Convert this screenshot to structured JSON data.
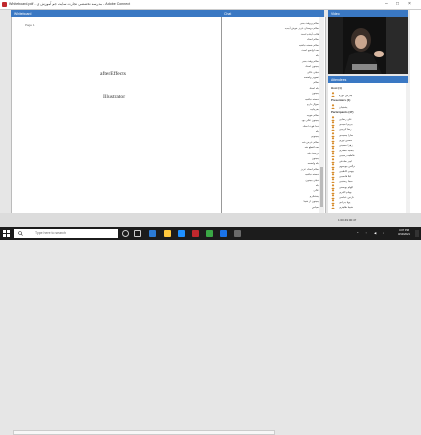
{
  "window": {
    "title": "Whiteboard.pdf - مدرسه تخصصی تجارت سایت جم آموزش ی - Adobe Connect"
  },
  "whiteboard": {
    "header": "Whiteboard",
    "page_label": "Page 1",
    "items": [
      "afterEffects",
      "Illustrator"
    ]
  },
  "chat": {
    "header": "Chat",
    "messages": [
      "سلام و وقت بخیر",
      "سلام دوستان عزیز خوش آمدید",
      "قالب آماده است",
      "سلام استاد",
      "سلام خسته نباشید",
      "صدا واضح است",
      "بله",
      "سلام وقت بخیر",
      "ممنون استاد",
      "خیلی عالی",
      "تصویر واضحه",
      "سلام",
      "بله استاد",
      "ممنون",
      "خسته نباشید",
      "سوال دارم",
      "بفرمایید",
      "سلام خوبید",
      "ممنون عالی بود",
      "خدا قوت استاد",
      "بله",
      "ممنونم",
      "سلام عرض شد",
      "صدا قطع شد",
      "درست شد",
      "ممنون",
      "بله واضحه",
      "سلام استاد عزیز",
      "خسته نباشید",
      "خیلی ممنون",
      "بله",
      "عالی",
      "متشکرم",
      "ممنون از شما",
      "سپاس"
    ]
  },
  "video": {
    "header": "Video"
  },
  "attendees": {
    "header": "Attendees",
    "groups": [
      {
        "label": "Host (1)",
        "names": [
          "مدرس دوره"
        ]
      },
      {
        "label": "Presenters (1)",
        "names": [
          "پشتیبان"
        ]
      },
      {
        "label": "Participants (47)",
        "names": [
          "علی رضایی",
          "مریم احمدی",
          "رضا کریمی",
          "سارا محمدی",
          "حسین نوری",
          "زهرا حسینی",
          "محمد جعفری",
          "فاطمه رحیمی",
          "امیر صادقی",
          "نرگس موسوی",
          "مهدی کاظمی",
          "لیلا قاسمی",
          "سینا رستمی",
          "الهام یوسفی",
          "بهنام اکبری",
          "نازنین عباسی",
          "پویا مرادی",
          "شیما طاهری"
        ]
      }
    ]
  },
  "status": {
    "elapsed": "1:00:49:00:47"
  },
  "taskbar": {
    "search_placeholder": "Type here to search",
    "time": "4:07 PM",
    "date": "3/10/2021"
  }
}
